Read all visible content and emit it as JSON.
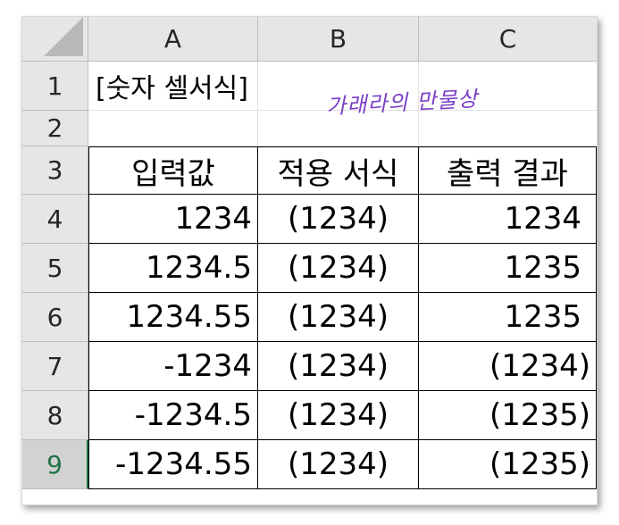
{
  "columns": [
    "A",
    "B",
    "C"
  ],
  "rows": [
    "1",
    "2",
    "3",
    "4",
    "5",
    "6",
    "7",
    "8",
    "9"
  ],
  "title_cell": "[숫자 셀서식]",
  "signature": "가래라의 만물상",
  "table": {
    "headers": [
      "입력값",
      "적용 서식",
      "출력 결과"
    ],
    "data": [
      [
        "1234",
        "(1234)",
        "1234"
      ],
      [
        "1234.5",
        "(1234)",
        "1235"
      ],
      [
        "1234.55",
        "(1234)",
        "1235"
      ],
      [
        "-1234",
        "(1234)",
        "(1234)"
      ],
      [
        "-1234.5",
        "(1234)",
        "(1235)"
      ],
      [
        "-1234.55",
        "(1234)",
        "(1235)"
      ]
    ]
  },
  "selected_row": "9",
  "colors": {
    "header_bg": "#e6e6e6",
    "selected_row_accent": "#217346",
    "signature": "#7a3fc6"
  }
}
